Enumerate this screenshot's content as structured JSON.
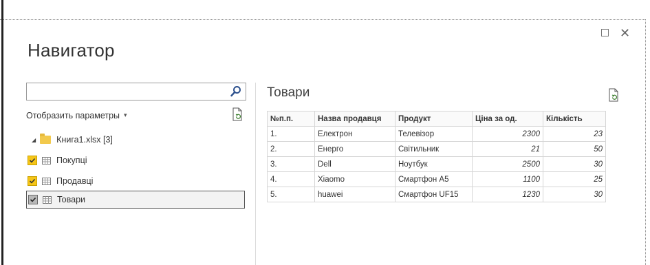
{
  "window": {
    "title": "Навигатор",
    "maximize_glyph": "☐",
    "close_glyph": "✕"
  },
  "left_panel": {
    "search_placeholder": "",
    "options_label": "Отобразить параметры",
    "options_caret": "▾",
    "file": {
      "label": "Книга1.xlsx [3]",
      "icon": "folder-icon"
    },
    "items": [
      {
        "label": "Покупці",
        "checked": true,
        "selected": false,
        "icon": "table-icon"
      },
      {
        "label": "Продавці",
        "checked": true,
        "selected": false,
        "icon": "table-icon"
      },
      {
        "label": "Товари",
        "checked": true,
        "selected": true,
        "icon": "table-icon"
      }
    ]
  },
  "preview": {
    "title": "Товари",
    "columns": [
      "№п.п.",
      "Назва продавця",
      "Продукт",
      "Ціна за од.",
      "Кількість"
    ],
    "rows": [
      [
        "1.",
        "Електрон",
        "Телевізор",
        "2300",
        "23"
      ],
      [
        "2.",
        "Енерго",
        "Світильник",
        "21",
        "50"
      ],
      [
        "3.",
        "Dell",
        "Ноутбук",
        "2500",
        "30"
      ],
      [
        "4.",
        "Xiaomo",
        "Смартфон А5",
        "1100",
        "25"
      ],
      [
        "5.",
        "huawei",
        "Смартфон UF15",
        "1230",
        "30"
      ]
    ]
  },
  "colors": {
    "checkbox_checked": "#f5c518",
    "folder": "#f2c94c",
    "search_icon": "#2b4f8c"
  }
}
